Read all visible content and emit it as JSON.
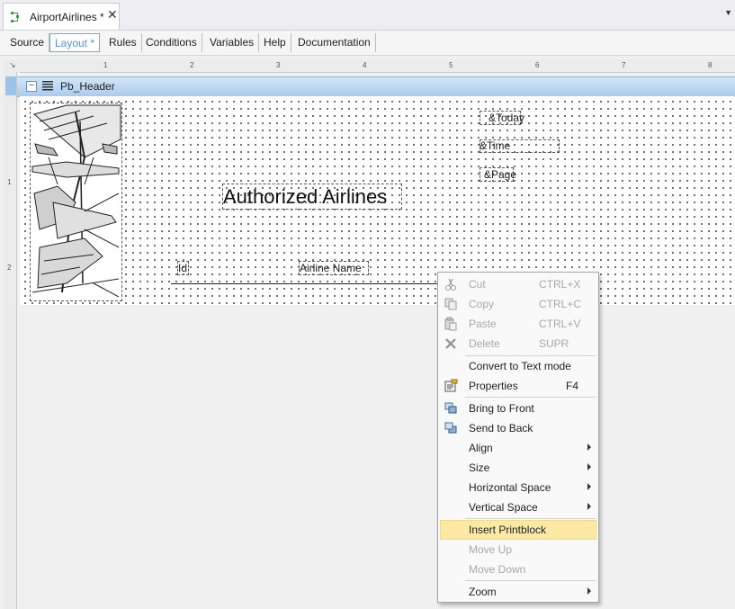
{
  "document_tab": {
    "title": "AirportAirlines *",
    "close": "✕"
  },
  "view_tabs": [
    "Source",
    "Layout *",
    "Rules",
    "Conditions",
    "Variables",
    "Help",
    "Documentation"
  ],
  "ruler": {
    "horizontal": [
      "1",
      "2",
      "3",
      "4",
      "5",
      "6",
      "7",
      "8"
    ],
    "vertical": [
      "1",
      "2"
    ]
  },
  "band": {
    "label": "Pb_Header",
    "collapse_glyph": "−"
  },
  "fields": {
    "today": "&Today",
    "time": "&Time",
    "page": "&Page",
    "title": "Authorized Airlines",
    "col_id": "Id",
    "col_name": "Airline Name"
  },
  "context_menu": {
    "items": [
      {
        "label": "Cut",
        "shortcut": "CTRL+X",
        "disabled": true,
        "icon": "scissors-icon"
      },
      {
        "label": "Copy",
        "shortcut": "CTRL+C",
        "disabled": true,
        "icon": "copy-icon"
      },
      {
        "label": "Paste",
        "shortcut": "CTRL+V",
        "disabled": true,
        "icon": "paste-icon"
      },
      {
        "label": "Delete",
        "shortcut": "SUPR",
        "disabled": true,
        "icon": "delete-icon"
      },
      {
        "label": "Convert to Text mode",
        "shortcut": "",
        "disabled": false,
        "icon": ""
      },
      {
        "label": "Properties",
        "shortcut": "F4",
        "disabled": false,
        "icon": "properties-icon"
      },
      {
        "label": "Bring to Front",
        "shortcut": "",
        "disabled": false,
        "icon": "bring-to-front-icon"
      },
      {
        "label": "Send to Back",
        "shortcut": "",
        "disabled": false,
        "icon": "send-to-back-icon"
      },
      {
        "label": "Align",
        "submenu": true
      },
      {
        "label": "Size",
        "submenu": true
      },
      {
        "label": "Horizontal Space",
        "submenu": true
      },
      {
        "label": "Vertical Space",
        "submenu": true
      },
      {
        "label": "Insert Printblock",
        "highlighted": true
      },
      {
        "label": "Move Up",
        "disabled": true
      },
      {
        "label": "Move Down",
        "disabled": true
      },
      {
        "label": "Zoom",
        "submenu": true
      }
    ]
  },
  "colors": {
    "accent": "#5a8fc8",
    "band": "#aacbec",
    "highlight": "#fde9a6"
  }
}
